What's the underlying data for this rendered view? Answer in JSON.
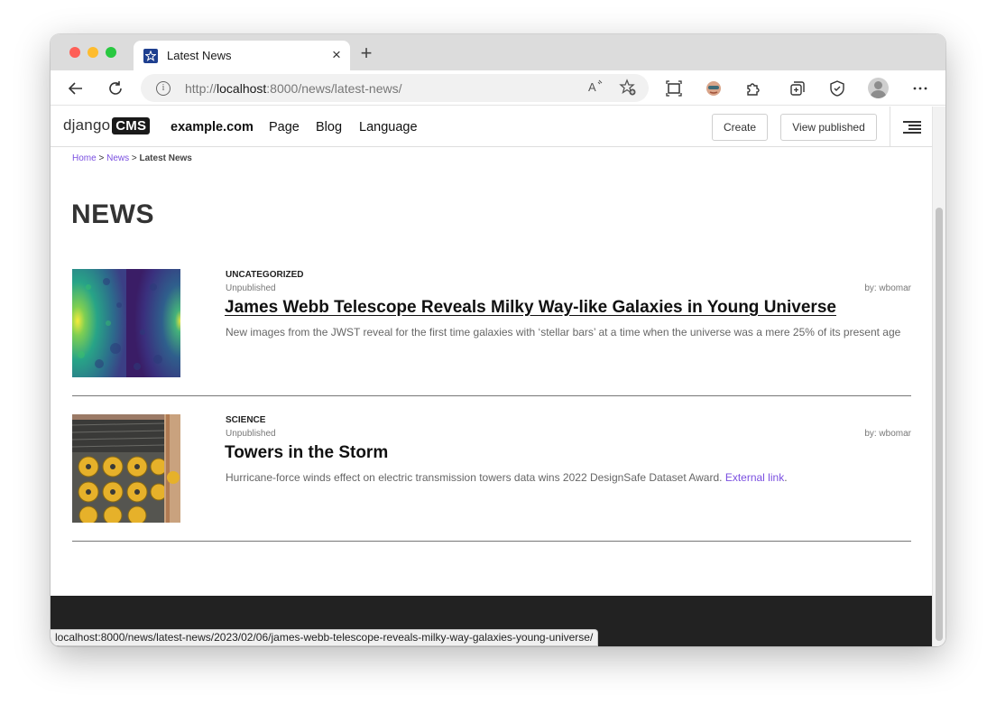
{
  "browser": {
    "tab_title": "Latest News",
    "tab_close": "×",
    "new_tab": "+",
    "url_prefix": "http://",
    "url_host": "localhost",
    "url_rest": ":8000/news/latest-news/",
    "status_url": "localhost:8000/news/latest-news/2023/02/06/james-webb-telescope-reveals-milky-way-galaxies-young-universe/"
  },
  "cms_toolbar": {
    "logo_text": "django",
    "logo_box": "CMS",
    "site": "example.com",
    "menu": [
      "Page",
      "Blog",
      "Language"
    ],
    "create_label": "Create",
    "view_published_label": "View published"
  },
  "breadcrumb": {
    "home": "Home",
    "news": "News",
    "current": "Latest News",
    "separator": ">"
  },
  "page": {
    "title": "NEWS"
  },
  "articles": [
    {
      "category": "UNCATEGORIZED",
      "status": "Unpublished",
      "author": "by: wbomar",
      "title": "James Webb Telescope Reveals Milky Way-like Galaxies in Young Universe",
      "lead": "New images from the JWST reveal for the first time galaxies with ‘stellar bars’ at a time when the universe was a mere 25% of its present age"
    },
    {
      "category": "SCIENCE",
      "status": "Unpublished",
      "author": "by: wbomar",
      "title": "Towers in the Storm",
      "lead": "Hurricane-force winds effect on electric transmission towers data wins 2022 DesignSafe Dataset Award. ",
      "link_text": "External link",
      "lead_end": "."
    }
  ],
  "colors": {
    "link": "#7a4fe0",
    "footer": "#222222"
  }
}
